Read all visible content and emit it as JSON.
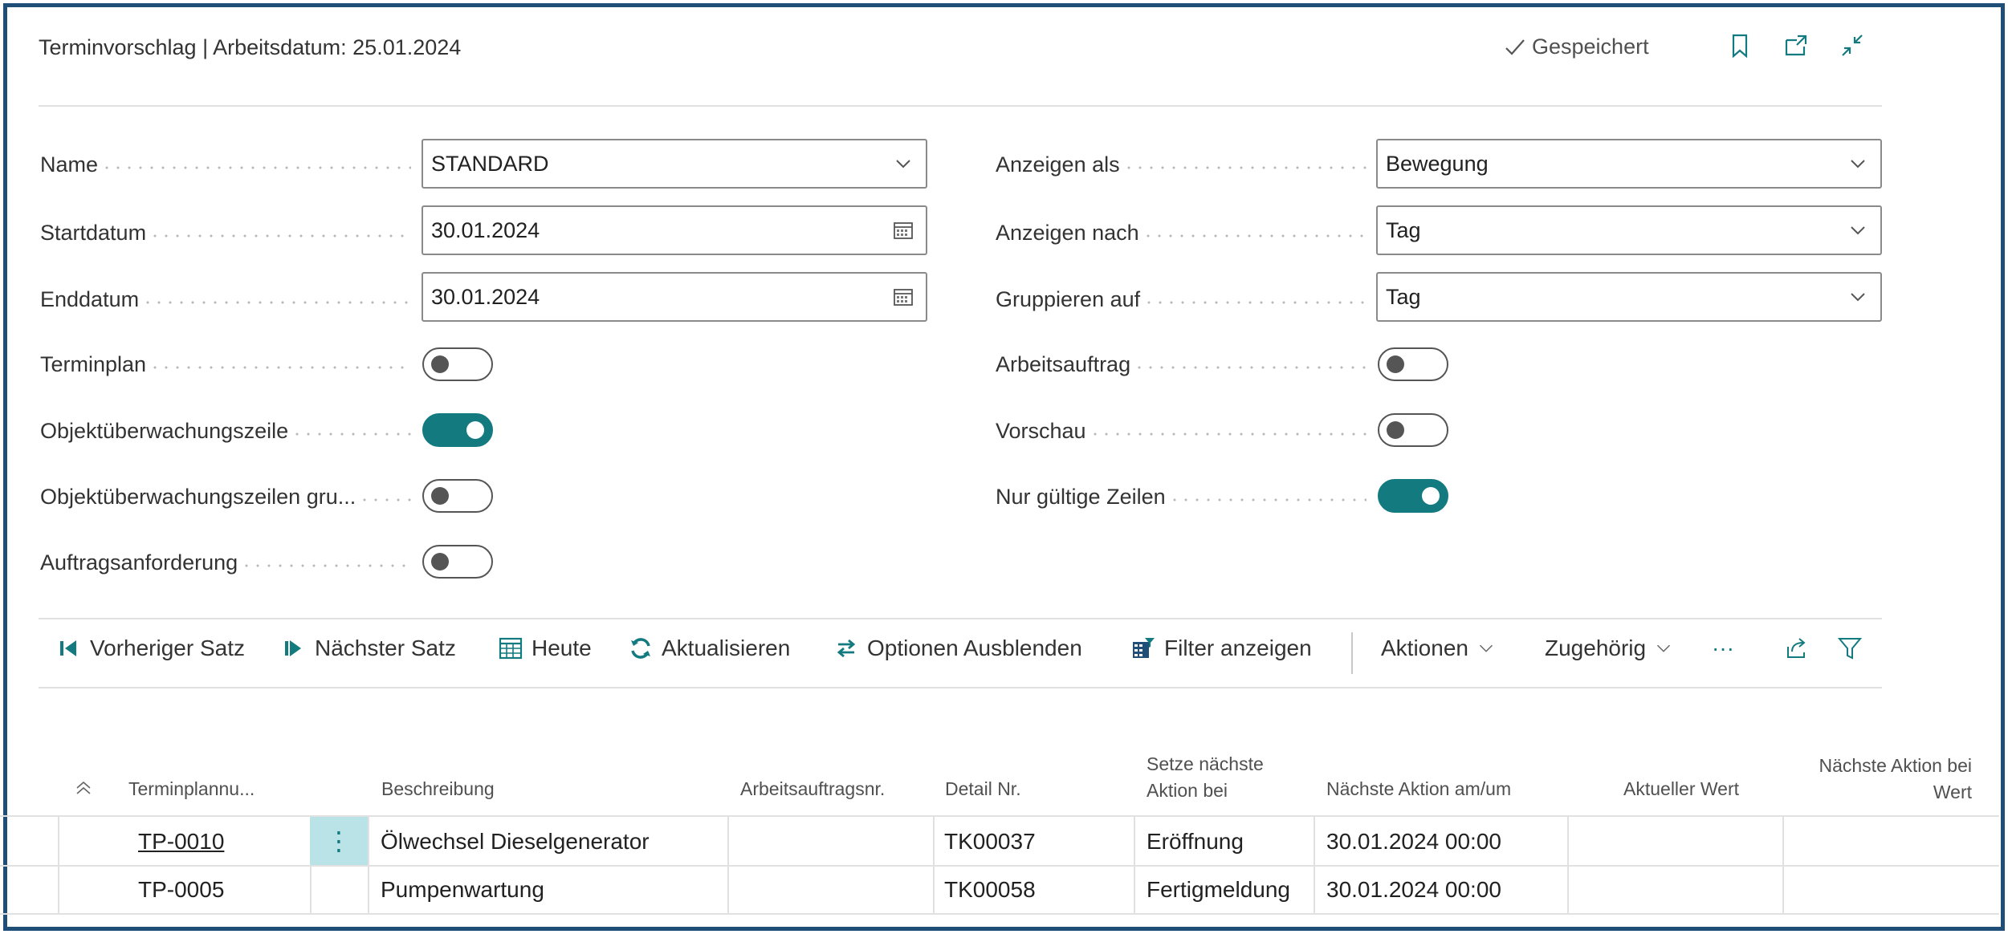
{
  "header": {
    "title": "Terminvorschlag | Arbeitsdatum: 25.01.2024",
    "saved_label": "Gespeichert",
    "icons": [
      "bookmark-icon",
      "open-new-window-icon",
      "collapse-icon"
    ]
  },
  "form": {
    "left": {
      "name_label": "Name",
      "name_value": "STANDARD",
      "startdatum_label": "Startdatum",
      "startdatum_value": "30.01.2024",
      "enddatum_label": "Enddatum",
      "enddatum_value": "30.01.2024",
      "terminplan_label": "Terminplan",
      "terminplan_on": false,
      "objektzeile_label": "Objektüberwachungszeile",
      "objektzeile_on": true,
      "objektzeilen_gru_label": "Objektüberwachungszeilen gru...",
      "objektzeilen_gru_on": false,
      "auftragsanforderung_label": "Auftragsanforderung",
      "auftragsanforderung_on": false
    },
    "right": {
      "anzeigen_als_label": "Anzeigen als",
      "anzeigen_als_value": "Bewegung",
      "anzeigen_nach_label": "Anzeigen nach",
      "anzeigen_nach_value": "Tag",
      "gruppieren_auf_label": "Gruppieren auf",
      "gruppieren_auf_value": "Tag",
      "arbeitsauftrag_label": "Arbeitsauftrag",
      "arbeitsauftrag_on": false,
      "vorschau_label": "Vorschau",
      "vorschau_on": false,
      "nur_gueltige_label": "Nur gültige Zeilen",
      "nur_gueltige_on": true
    }
  },
  "actions": {
    "prev": "Vorheriger Satz",
    "next": "Nächster Satz",
    "today": "Heute",
    "refresh": "Aktualisieren",
    "hide_options": "Optionen Ausblenden",
    "show_filter": "Filter anzeigen",
    "aktionen": "Aktionen",
    "zugehoerig": "Zugehörig",
    "more": "···"
  },
  "table": {
    "headers": {
      "terminplanung": "Terminplannu...",
      "beschreibung": "Beschreibung",
      "arbeitsauftragsnr": "Arbeitsauftragsnr.",
      "detail_nr": "Detail Nr.",
      "setze_line1": "Setze nächste",
      "setze_line2": "Aktion bei",
      "naechste_aktion_am": "Nächste Aktion am/um",
      "aktueller_wert": "Aktueller Wert",
      "naechste_wert_line1": "Nächste Aktion bei",
      "naechste_wert_line2": "Wert"
    },
    "rows": [
      {
        "terminplanung": "TP-0010",
        "beschreibung": "Ölwechsel Dieselgenerator",
        "arbeitsauftragsnr": "",
        "detail_nr": "TK00037",
        "setze": "Eröffnung",
        "naechste_aktion_am": "30.01.2024 00:00",
        "aktueller_wert": "",
        "naechste_wert": ""
      },
      {
        "terminplanung": "TP-0005",
        "beschreibung": "Pumpenwartung",
        "arbeitsauftragsnr": "",
        "detail_nr": "TK00058",
        "setze": "Fertigmeldung",
        "naechste_aktion_am": "30.01.2024 00:00",
        "aktueller_wert": "",
        "naechste_wert": ""
      }
    ]
  },
  "colors": {
    "accent": "#137a80",
    "frame": "#1f4e79",
    "row_menu_bg": "#b9e3e7"
  }
}
